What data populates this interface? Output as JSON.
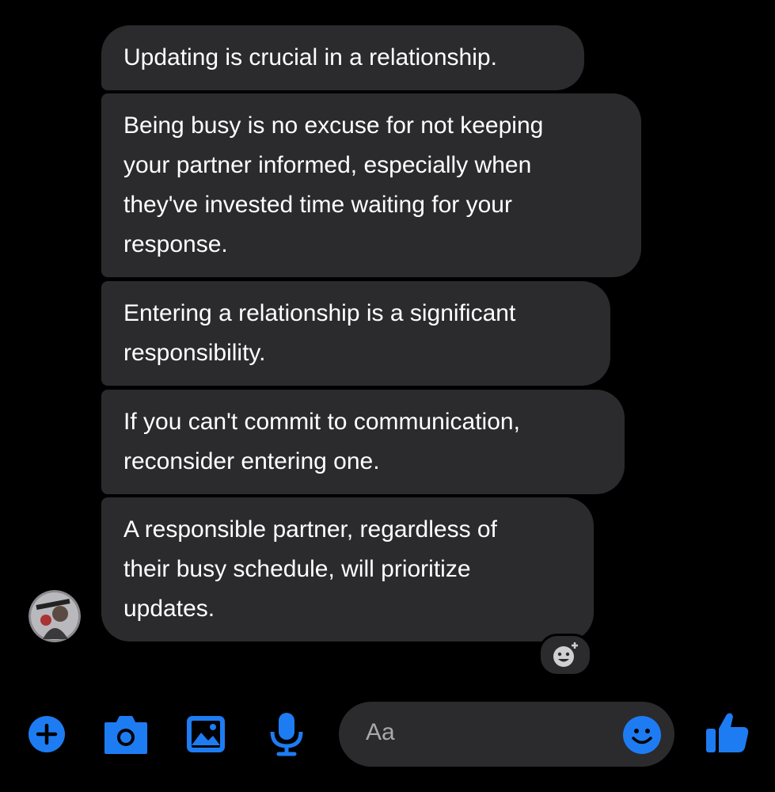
{
  "messages": [
    {
      "lines": [
        "Updating is crucial in a relationship."
      ]
    },
    {
      "lines": [
        "Being busy is no excuse for not keeping",
        "your partner informed, especially when",
        "they've invested time waiting for your",
        "response."
      ]
    },
    {
      "lines": [
        "Entering a relationship is a significant",
        "responsibility."
      ]
    },
    {
      "lines": [
        "If you can't commit to communication,",
        "reconsider entering one."
      ]
    },
    {
      "lines": [
        "A responsible partner, regardless of",
        "their busy schedule, will prioritize",
        "updates."
      ]
    }
  ],
  "composer": {
    "placeholder": "Aa"
  },
  "colors": {
    "accent": "#1e7cf2",
    "bubble": "#2b2b2d",
    "background": "#000000"
  },
  "icons": [
    "plus-icon",
    "camera-icon",
    "image-icon",
    "microphone-icon",
    "emoji-icon",
    "thumbs-up-icon",
    "add-reaction-icon"
  ]
}
